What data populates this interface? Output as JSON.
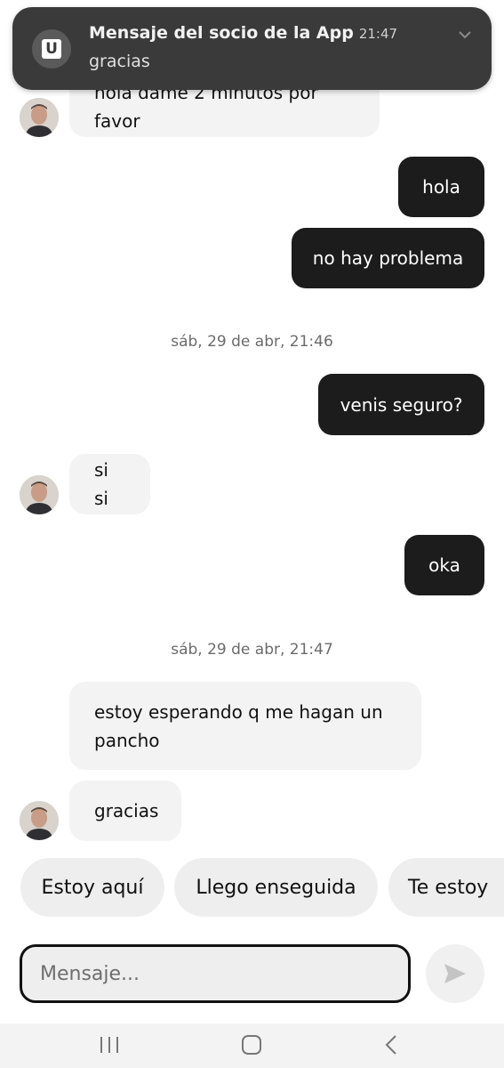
{
  "notification": {
    "app_icon": "uber-u-icon",
    "title": "Mensaje del socio de la App",
    "time": "21:47",
    "body": "gracias"
  },
  "messages": {
    "m1": "hola dame 2 minutos por favor",
    "m2": "hola",
    "m3": "no hay problema",
    "stamp1": "sáb, 29 de abr, 21:46",
    "m4": "venis seguro?",
    "m5": "si si",
    "m6": "oka",
    "stamp2": "sáb, 29 de abr, 21:47",
    "m7_line1": "estoy esperando q me hagan un",
    "m7_line2": "pancho",
    "m8": "gracias"
  },
  "quick_replies": [
    "Estoy aquí",
    "Llego enseguida",
    "Te estoy"
  ],
  "composer": {
    "placeholder": "Mensaje...",
    "send_icon": "send-arrow-icon"
  },
  "system_nav": {
    "icons": [
      "recent-apps-icon",
      "home-icon",
      "back-icon"
    ]
  },
  "colors": {
    "outgoing_bubble": "#1c1c1c",
    "incoming_bubble": "#f3f3f3",
    "notification_bg": "#3a3a3a"
  }
}
